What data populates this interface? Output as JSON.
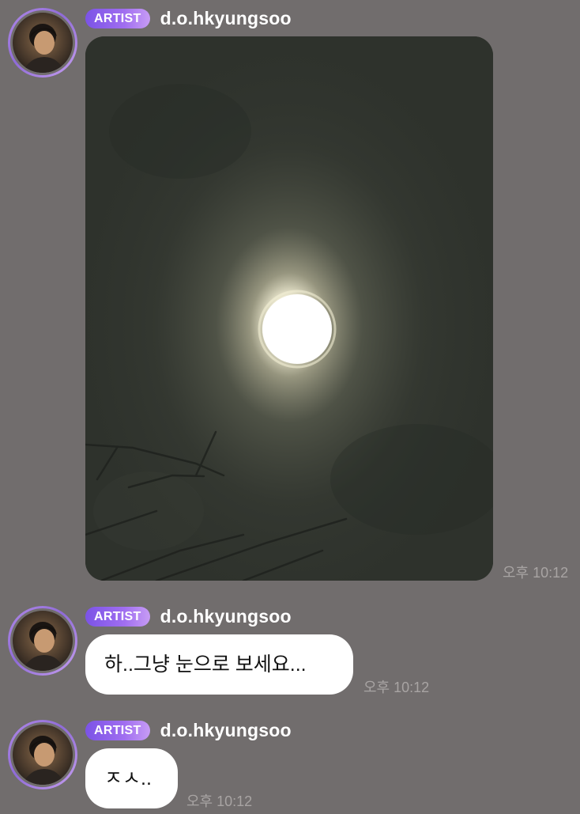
{
  "app": {
    "background_color": "#716d6d",
    "accent_badge_color": "#8e61ea"
  },
  "messages": [
    {
      "badge": "ARTIST",
      "username": "d.o.hkyungsoo",
      "type": "image",
      "image_description_icon": "moon-photo",
      "time": "오후 10:12"
    },
    {
      "badge": "ARTIST",
      "username": "d.o.hkyungsoo",
      "type": "text",
      "text": "하..그냥 눈으로 보세요...",
      "time": "오후 10:12"
    },
    {
      "badge": "ARTIST",
      "username": "d.o.hkyungsoo",
      "type": "text",
      "text": "ㅈㅅ..",
      "time": "오후 10:12"
    }
  ]
}
